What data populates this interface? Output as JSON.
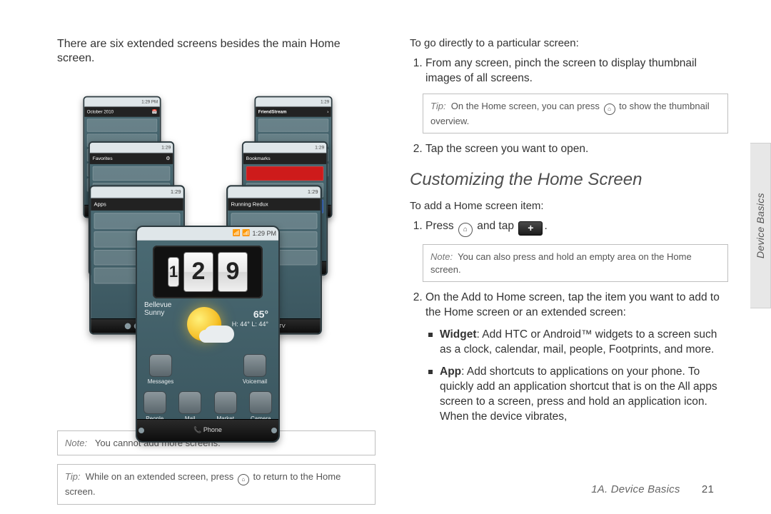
{
  "left": {
    "intro": "There are six extended screens besides the main Home screen.",
    "phones": {
      "p1_status_time": "1:29 PM",
      "p2_topbar": "FriendStream",
      "p4_topbar": "Bookmarks",
      "p6_topbar": "Running Redux",
      "center": {
        "status_time": "1:29 PM",
        "clock_hour": "1",
        "clock_min1": "2",
        "clock_min2": "9",
        "city": "Bellevue",
        "daylabel": "Sunny",
        "temp_big": "65°",
        "temp_hilo": "H: 44°\nL: 44°",
        "row1": [
          "Messages",
          "",
          "Voicemail"
        ],
        "row2": [
          "People",
          "Mail",
          "Market",
          "Camera"
        ],
        "dock": "📞 Phone"
      }
    },
    "note": {
      "lead": "Note:",
      "body": "You cannot add more screens."
    },
    "tip": {
      "lead": "Tip:",
      "pre": "While on an extended screen, press",
      "post": "to return to the Home screen."
    }
  },
  "right": {
    "subhead1": "To go directly to a particular screen:",
    "steps1": [
      "From any screen, pinch the screen to display thumbnail images of all screens.",
      "Tap the screen you want to open."
    ],
    "tip1": {
      "lead": "Tip:",
      "pre": "On the Home screen, you can press",
      "post": "to show the thumbnail overview."
    },
    "heading": "Customizing the Home Screen",
    "subhead2": "To add a Home screen item:",
    "step2_1_pre": "Press",
    "step2_1_mid": "and tap",
    "step2_1_post": ".",
    "note2": {
      "lead": "Note:",
      "body": "You can also press and hold an empty area on the Home screen."
    },
    "step2_2": "On the Add to Home screen, tap the item you want to add to the Home screen or an extended screen:",
    "bullets": [
      {
        "term": "Widget",
        "body": ": Add HTC or Android™ widgets to a screen such as a clock, calendar, mail, people, Footprints, and more."
      },
      {
        "term": "App",
        "body": ": Add shortcuts to applications on your phone. To quickly add an application shortcut that is on the All apps screen to a screen, press and hold an application icon. When the device vibrates,"
      }
    ]
  },
  "sidetab": "Device Basics",
  "footer": {
    "chapter": "1A. Device Basics",
    "page": "21"
  },
  "icons": {
    "home_glyph": "⌂",
    "plus_glyph": "+"
  }
}
